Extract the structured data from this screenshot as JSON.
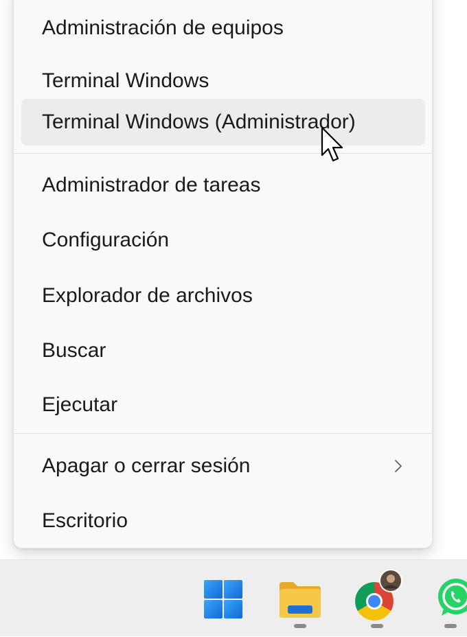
{
  "menu": {
    "items": [
      {
        "label": "Administración de equipos"
      },
      {
        "label": "Terminal Windows"
      },
      {
        "label": "Terminal Windows (Administrador)"
      },
      {
        "label": "Administrador de tareas"
      },
      {
        "label": "Configuración"
      },
      {
        "label": "Explorador de archivos"
      },
      {
        "label": "Buscar"
      },
      {
        "label": "Ejecutar"
      },
      {
        "label": "Apagar o cerrar sesión"
      },
      {
        "label": "Escritorio"
      }
    ],
    "hovered_item": "Terminal Windows (Administrador)"
  },
  "taskbar": {
    "icons": [
      "windows-start-icon",
      "file-explorer-icon",
      "chrome-icon",
      "whatsapp-icon"
    ],
    "colors": {
      "start_blue": "#1a7fe6",
      "folder_yellow": "#f7c847",
      "folder_blue": "#1d6fd1",
      "whatsapp_green": "#25d366"
    }
  }
}
